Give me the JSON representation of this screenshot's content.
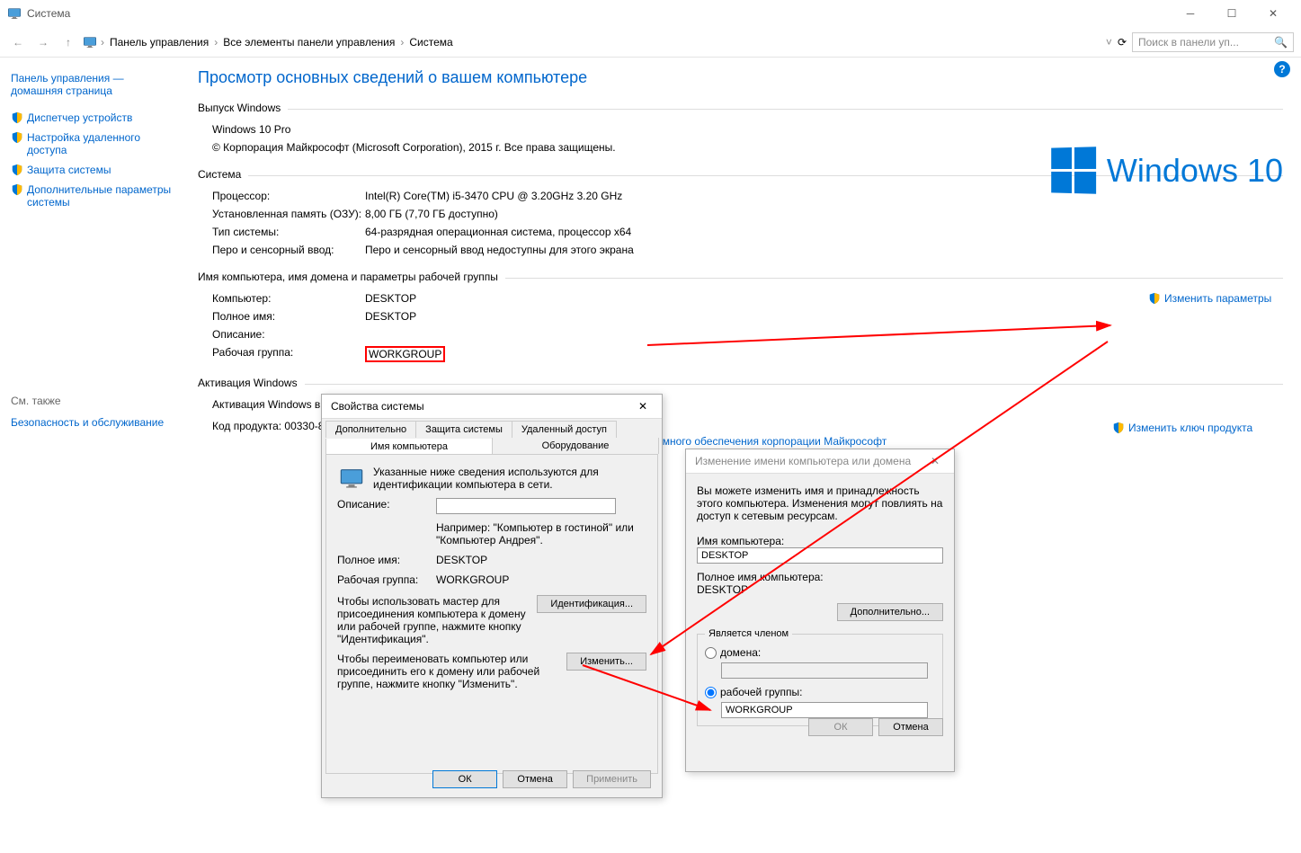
{
  "window": {
    "title": "Система"
  },
  "breadcrumb": {
    "items": [
      "Панель управления",
      "Все элементы панели управления",
      "Система"
    ]
  },
  "search": {
    "placeholder": "Поиск в панели уп..."
  },
  "sidebar": {
    "home": "Панель управления — домашняя страница",
    "items": [
      "Диспетчер устройств",
      "Настройка удаленного доступа",
      "Защита системы",
      "Дополнительные параметры системы"
    ],
    "see_also_head": "См. также",
    "see_also": "Безопасность и обслуживание"
  },
  "page": {
    "title": "Просмотр основных сведений о вашем компьютере",
    "edition_head": "Выпуск Windows",
    "edition": "Windows 10 Pro",
    "copyright": "© Корпорация Майкрософт (Microsoft Corporation), 2015 г. Все права защищены.",
    "logo_text": "Windows 10",
    "system_head": "Система",
    "sys": {
      "cpu_k": "Процессор:",
      "cpu_v": "Intel(R) Core(TM) i5-3470 CPU @ 3.20GHz   3.20 GHz",
      "ram_k": "Установленная память (ОЗУ):",
      "ram_v": "8,00 ГБ (7,70 ГБ доступно)",
      "type_k": "Тип системы:",
      "type_v": "64-разрядная операционная система, процессор x64",
      "pen_k": "Перо и сенсорный ввод:",
      "pen_v": "Перо и сенсорный ввод недоступны для этого экрана"
    },
    "name_head": "Имя компьютера, имя домена и параметры рабочей группы",
    "name": {
      "computer_k": "Компьютер:",
      "computer_v": "DESKTOP",
      "full_k": "Полное имя:",
      "full_v": "DESKTOP",
      "desc_k": "Описание:",
      "desc_v": "",
      "wg_k": "Рабочая группа:",
      "wg_v": "WORKGROUP"
    },
    "change_settings": "Изменить параметры",
    "activation_head": "Активация Windows",
    "activation_line_prefix": "Активация Windows вы",
    "activation_link": "имного обеспечения корпорации Майкрософт",
    "product_key_line": "Код продукта: 00330-80",
    "change_key": "Изменить ключ продукта"
  },
  "dlg1": {
    "title": "Свойства системы",
    "tabs_row1": [
      "Дополнительно",
      "Защита системы",
      "Удаленный доступ"
    ],
    "tabs_row2": [
      "Имя компьютера",
      "Оборудование"
    ],
    "intro": "Указанные ниже сведения используются для идентификации компьютера в сети.",
    "desc_label": "Описание:",
    "desc_value": "",
    "example": "Например: \"Компьютер в гостиной\" или \"Компьютер Андрея\".",
    "full_k": "Полное имя:",
    "full_v": "DESKTOP",
    "wg_k": "Рабочая группа:",
    "wg_v": "WORKGROUP",
    "wizard_text": "Чтобы использовать мастер для присоединения компьютера к домену или рабочей группе, нажмите кнопку \"Идентификация\".",
    "wizard_btn": "Идентификация...",
    "rename_text": "Чтобы переименовать компьютер или присоединить его к домену или рабочей группе, нажмите кнопку \"Изменить\".",
    "rename_btn": "Изменить...",
    "ok": "ОК",
    "cancel": "Отмена",
    "apply": "Применить"
  },
  "dlg2": {
    "title": "Изменение имени компьютера или домена",
    "intro": "Вы можете изменить имя и принадлежность этого компьютера. Изменения могут повлиять на доступ к сетевым ресурсам.",
    "name_label": "Имя компьютера:",
    "name_value": "DESKTOP",
    "full_label": "Полное имя компьютера:",
    "full_value": "DESKTOP",
    "more_btn": "Дополнительно...",
    "member_legend": "Является членом",
    "domain_label": "домена:",
    "wg_label": "рабочей группы:",
    "wg_value": "WORKGROUP",
    "ok": "ОК",
    "cancel": "Отмена"
  }
}
